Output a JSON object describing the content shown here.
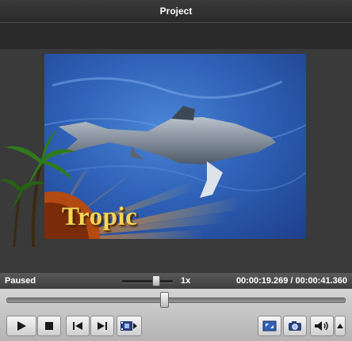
{
  "window": {
    "title": "Project"
  },
  "video": {
    "overlay_text": "Tropic"
  },
  "status": {
    "state": "Paused",
    "speed_label": "1x",
    "speed_fraction": 0.7,
    "current_time": "00:00:19.269",
    "total_time": "00:00:41.360",
    "time_display": "00:00:19.269 / 00:00:41.360"
  },
  "seek": {
    "progress_fraction": 0.466
  },
  "icons": {
    "play": "play-icon",
    "stop": "stop-icon",
    "previous": "skip-previous-icon",
    "next": "skip-next-icon",
    "clip": "film-clip-icon",
    "fullscreen": "fullscreen-icon",
    "snapshot": "camera-icon",
    "volume": "speaker-icon",
    "volume_menu": "chevron-up-icon"
  },
  "colors": {
    "overlay_text": "#f3d55a",
    "accent_blue": "#2f62b8"
  }
}
